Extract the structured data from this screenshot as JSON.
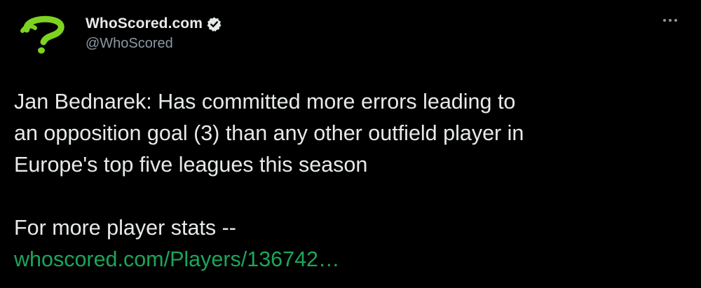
{
  "author": {
    "display_name": "WhoScored.com",
    "handle": "@WhoScored",
    "verified": true,
    "avatar_icon": "whoscored-question-mark-logo",
    "brand_color": "#7ed321"
  },
  "menu": {
    "icon": "more-horizontal-icon"
  },
  "tweet": {
    "lines": [
      "Jan Bednarek: Has committed more errors leading to",
      "an opposition goal (3) than any other outfield player in",
      "Europe's top five leagues this season"
    ],
    "cta": "For more player stats --",
    "link": "whoscored.com/Players/136742…",
    "link_color": "#1ba65a"
  },
  "theme": {
    "background": "#000000",
    "text_color": "#e7e9ea",
    "secondary_color": "#8b98a5"
  }
}
